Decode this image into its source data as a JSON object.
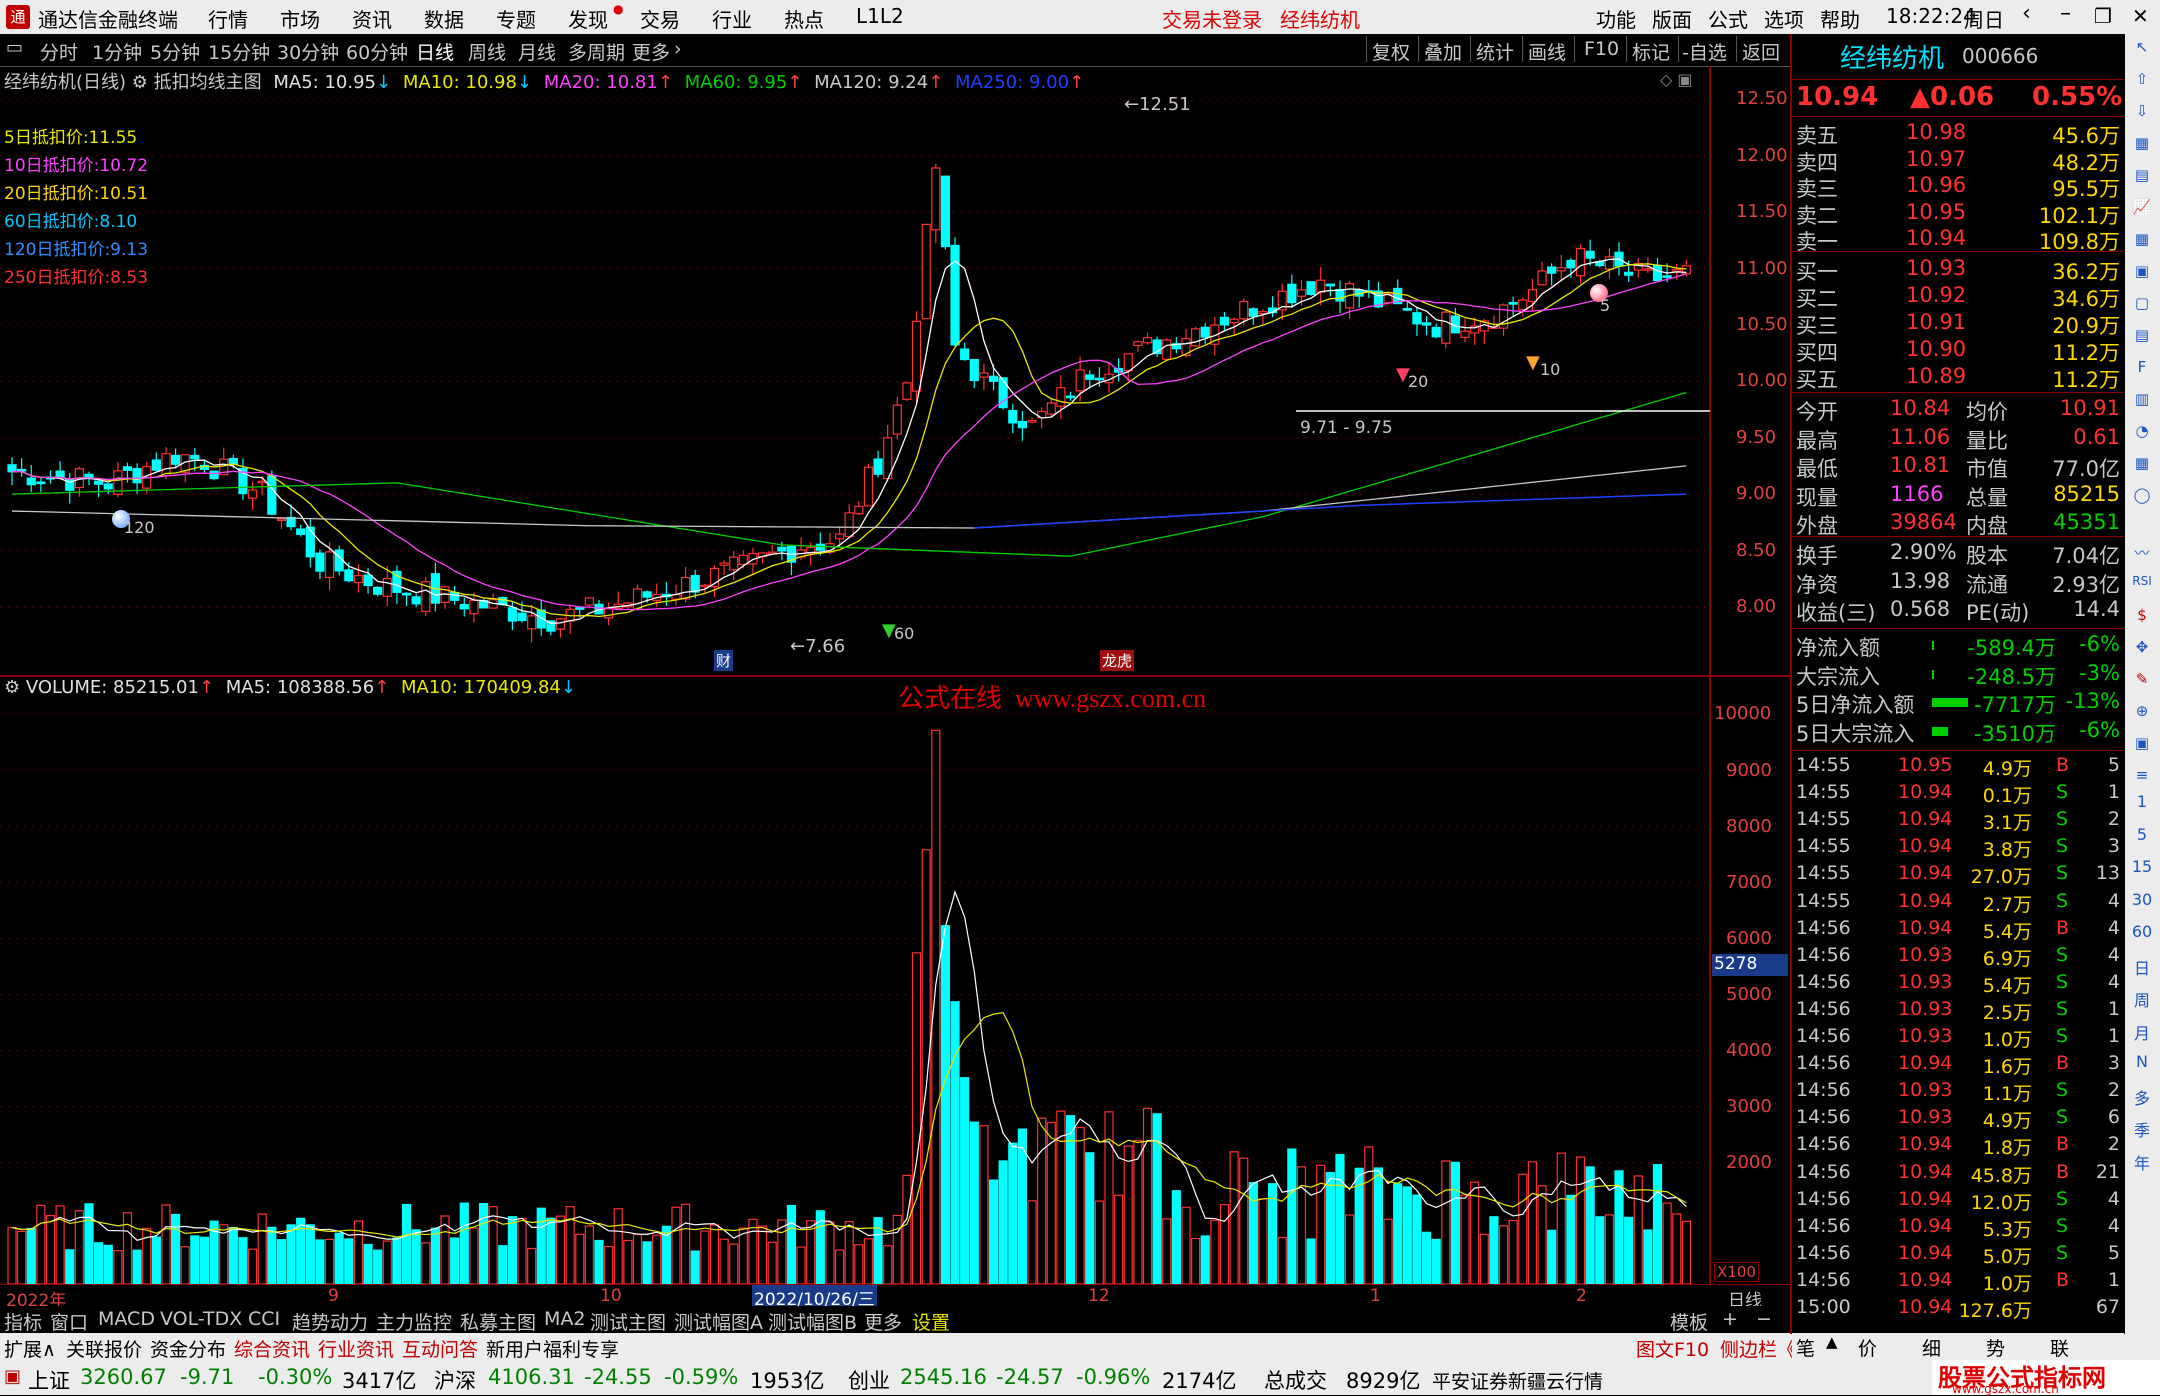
{
  "window": {
    "app_title": "通达信金融终端",
    "menu": [
      "行情",
      "市场",
      "资讯",
      "数据",
      "专题",
      "发现",
      "交易",
      "行业",
      "热点",
      "L1L2"
    ],
    "login_status": "交易未登录",
    "stock_name_title": "经纬纺机",
    "right_menu": [
      "功能",
      "版面",
      "公式",
      "选项",
      "帮助"
    ],
    "time": "18:22:24",
    "weekday": "周日"
  },
  "period_bar": {
    "periods": [
      "分时",
      "1分钟",
      "5分钟",
      "15分钟",
      "30分钟",
      "60分钟",
      "日线",
      "周线",
      "月线",
      "多周期",
      "更多"
    ],
    "active": "日线",
    "tools": [
      "复权",
      "叠加",
      "统计",
      "画线",
      "F10",
      "标记",
      "-自选",
      "返回"
    ]
  },
  "price_chart": {
    "header": {
      "stock": "经纬纺机(日线)",
      "indicator": "抵扣均线主图",
      "ma5": "MA5: 10.95",
      "ma10": "MA10: 10.98",
      "ma20": "MA20: 10.81",
      "ma60": "MA60: 9.95",
      "ma120": "MA120: 9.24",
      "ma250": "MA250: 9.00"
    },
    "side_labels": [
      {
        "text": "5日抵扣价:11.55",
        "color": "#e8e800"
      },
      {
        "text": "10日抵扣价:10.72",
        "color": "#ff40ff"
      },
      {
        "text": "20日抵扣价:10.51",
        "color": "#ffd700"
      },
      {
        "text": "60日抵扣价:8.10",
        "color": "#00c8ff"
      },
      {
        "text": "120日抵扣价:9.13",
        "color": "#3090ff"
      },
      {
        "text": "250日抵扣价:8.53",
        "color": "#ff3030"
      }
    ],
    "price_axis": [
      "12.50",
      "12.00",
      "11.50",
      "11.00",
      "10.50",
      "10.00",
      "9.50",
      "9.00",
      "8.50",
      "8.00"
    ],
    "annotations": {
      "high": "12.51",
      "low": "7.66",
      "range": "9.71 - 9.75",
      "marker_120": "120",
      "marker_60": "60",
      "marker_20": "20",
      "marker_10": "10",
      "marker_5": "5",
      "cai": "财",
      "long": "龙虎"
    }
  },
  "volume_chart": {
    "header": {
      "vol": "VOLUME: 85215.01",
      "ma5": "MA5: 108388.56",
      "ma10": "MA10: 170409.84"
    },
    "watermark": "公式在线  www.gszx.com.cn",
    "axis": [
      "10000",
      "9000",
      "8000",
      "7000",
      "6000",
      "5000",
      "4000",
      "3000",
      "2000"
    ],
    "cursor_value": "5278",
    "unit": "X100"
  },
  "time_axis": {
    "labels": [
      "2022年",
      "9",
      "10",
      "2022/10/26/三",
      "12",
      "1",
      "2"
    ],
    "period": "日线"
  },
  "quote_panel": {
    "name": "经纬纺机",
    "code": "000666",
    "price": "10.94",
    "change": "▲0.06",
    "pct": "0.55%",
    "asks": [
      {
        "label": "卖五",
        "price": "10.98",
        "vol": "45.6万"
      },
      {
        "label": "卖四",
        "price": "10.97",
        "vol": "48.2万"
      },
      {
        "label": "卖三",
        "price": "10.96",
        "vol": "95.5万"
      },
      {
        "label": "卖二",
        "price": "10.95",
        "vol": "102.1万"
      },
      {
        "label": "卖一",
        "price": "10.94",
        "vol": "109.8万"
      }
    ],
    "bids": [
      {
        "label": "买一",
        "price": "10.93",
        "vol": "36.2万"
      },
      {
        "label": "买二",
        "price": "10.92",
        "vol": "34.6万"
      },
      {
        "label": "买三",
        "price": "10.91",
        "vol": "20.9万"
      },
      {
        "label": "买四",
        "price": "10.90",
        "vol": "11.2万"
      },
      {
        "label": "买五",
        "price": "10.89",
        "vol": "11.2万"
      }
    ],
    "stats": [
      {
        "l1": "今开",
        "v1": "10.84",
        "l2": "均价",
        "v2": "10.91"
      },
      {
        "l1": "最高",
        "v1": "11.06",
        "l2": "量比",
        "v2": "0.61"
      },
      {
        "l1": "最低",
        "v1": "10.81",
        "l2": "市值",
        "v2": "77.0亿"
      },
      {
        "l1": "现量",
        "v1": "1166",
        "l2": "总量",
        "v2": "85215"
      },
      {
        "l1": "外盘",
        "v1": "39864",
        "l2": "内盘",
        "v2": "45351"
      }
    ],
    "stats2": [
      {
        "l1": "换手",
        "v1": "2.90%",
        "l2": "股本",
        "v2": "7.04亿"
      },
      {
        "l1": "净资",
        "v1": "13.98",
        "l2": "流通",
        "v2": "2.93亿"
      },
      {
        "l1": "收益(三)",
        "v1": "0.568",
        "l2": "PE(动)",
        "v2": "14.4"
      }
    ],
    "flows": [
      {
        "label": "净流入额",
        "value": "-589.4万",
        "pct": "-6%"
      },
      {
        "label": "大宗流入",
        "value": "-248.5万",
        "pct": "-3%"
      },
      {
        "label": "5日净流入额",
        "value": "-7717万",
        "pct": "-13%"
      },
      {
        "label": "5日大宗流入",
        "value": "-3510万",
        "pct": "-6%"
      }
    ],
    "ticks": [
      {
        "t": "14:55",
        "p": "10.95",
        "v": "4.9万",
        "s": "B",
        "n": "5"
      },
      {
        "t": "14:55",
        "p": "10.94",
        "v": "0.1万",
        "s": "S",
        "n": "1"
      },
      {
        "t": "14:55",
        "p": "10.94",
        "v": "3.1万",
        "s": "S",
        "n": "2"
      },
      {
        "t": "14:55",
        "p": "10.94",
        "v": "3.8万",
        "s": "S",
        "n": "3"
      },
      {
        "t": "14:55",
        "p": "10.94",
        "v": "27.0万",
        "s": "S",
        "n": "13"
      },
      {
        "t": "14:55",
        "p": "10.94",
        "v": "2.7万",
        "s": "S",
        "n": "4"
      },
      {
        "t": "14:56",
        "p": "10.94",
        "v": "5.4万",
        "s": "B",
        "n": "4"
      },
      {
        "t": "14:56",
        "p": "10.93",
        "v": "6.9万",
        "s": "S",
        "n": "4"
      },
      {
        "t": "14:56",
        "p": "10.93",
        "v": "5.4万",
        "s": "S",
        "n": "4"
      },
      {
        "t": "14:56",
        "p": "10.93",
        "v": "2.5万",
        "s": "S",
        "n": "1"
      },
      {
        "t": "14:56",
        "p": "10.93",
        "v": "1.0万",
        "s": "S",
        "n": "1"
      },
      {
        "t": "14:56",
        "p": "10.94",
        "v": "1.6万",
        "s": "B",
        "n": "3"
      },
      {
        "t": "14:56",
        "p": "10.93",
        "v": "1.1万",
        "s": "S",
        "n": "2"
      },
      {
        "t": "14:56",
        "p": "10.93",
        "v": "4.9万",
        "s": "S",
        "n": "6"
      },
      {
        "t": "14:56",
        "p": "10.94",
        "v": "1.8万",
        "s": "B",
        "n": "2"
      },
      {
        "t": "14:56",
        "p": "10.94",
        "v": "45.8万",
        "s": "B",
        "n": "21"
      },
      {
        "t": "14:56",
        "p": "10.94",
        "v": "12.0万",
        "s": "S",
        "n": "4"
      },
      {
        "t": "14:56",
        "p": "10.94",
        "v": "5.3万",
        "s": "S",
        "n": "4"
      },
      {
        "t": "14:56",
        "p": "10.94",
        "v": "5.0万",
        "s": "S",
        "n": "5"
      },
      {
        "t": "14:56",
        "p": "10.94",
        "v": "1.0万",
        "s": "B",
        "n": "1"
      },
      {
        "t": "15:00",
        "p": "10.94",
        "v": "127.6万",
        "s": "",
        "n": "67"
      }
    ],
    "bottom_tabs": [
      "笔",
      "价",
      "细",
      "势",
      "联"
    ]
  },
  "icon_bar": [
    "1",
    "5",
    "15",
    "30",
    "60",
    "日",
    "周",
    "月",
    "N",
    "多",
    "季",
    "年"
  ],
  "indicator_tabs": [
    "指标",
    "窗口",
    "MACD",
    "VOL-TDX",
    "CCI",
    "趋势动力",
    "主力监控",
    "私募主图",
    "MA2",
    "测试主图",
    "测试幅图A",
    "测试幅图B",
    "更多",
    "设置",
    "模板",
    "+",
    "−"
  ],
  "info_tabs": [
    "扩展∧",
    "关联报价",
    "资金分布",
    "综合资讯",
    "行业资讯",
    "互动问答",
    "新用户福利专享"
  ],
  "info_right": [
    "图文F10",
    "侧边栏《"
  ],
  "status_bar": {
    "sh_name": "上证",
    "sh_val": "3260.67",
    "sh_chg": "-9.71",
    "sh_pct": "-0.30%",
    "sh_amt": "3417亿",
    "hs_name": "沪深",
    "hs_val": "4106.31",
    "hs_chg": "-24.55",
    "hs_pct": "-0.59%",
    "hs_amt": "1953亿",
    "cy_name": "创业",
    "cy_val": "2545.16",
    "cy_chg": "-24.57",
    "cy_pct": "-0.96%",
    "cy_amt": "2174亿",
    "total_label": "总成交",
    "total_val": "8929亿",
    "broker": "平安证券新疆云行情"
  },
  "watermark_logo": {
    "title": "股票公式指标网",
    "url": "www.gszx.com.cn"
  }
}
